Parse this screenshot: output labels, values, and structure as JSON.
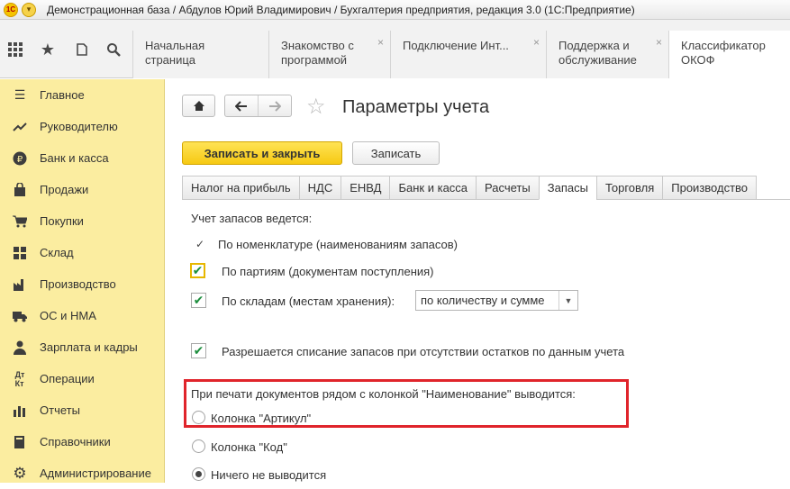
{
  "window": {
    "title": "Демонстрационная база / Абдулов Юрий Владимирович / Бухгалтерия предприятия, редакция 3.0  (1С:Предприятие)",
    "logo_text": "1С"
  },
  "toolbar": {
    "icons": [
      "apps-grid-icon",
      "star-icon",
      "history-icon",
      "search-icon"
    ]
  },
  "top_tabs": [
    {
      "label": "Начальная страница",
      "closable": false
    },
    {
      "label": "Знакомство с программой",
      "closable": true
    },
    {
      "label": "Подключение Инт...",
      "closable": true
    },
    {
      "label": "Поддержка и обслуживание",
      "closable": true
    },
    {
      "label": "Классификатор ОКОФ",
      "closable": false
    }
  ],
  "sidebar": {
    "items": [
      {
        "label": "Главное",
        "icon": "menu-lines-icon"
      },
      {
        "label": "Руководителю",
        "icon": "trend-icon"
      },
      {
        "label": "Банк и касса",
        "icon": "ruble-icon"
      },
      {
        "label": "Продажи",
        "icon": "bag-icon"
      },
      {
        "label": "Покупки",
        "icon": "cart-icon"
      },
      {
        "label": "Склад",
        "icon": "warehouse-icon"
      },
      {
        "label": "Производство",
        "icon": "factory-icon"
      },
      {
        "label": "ОС и НМА",
        "icon": "truck-icon"
      },
      {
        "label": "Зарплата и кадры",
        "icon": "person-icon"
      },
      {
        "label": "Операции",
        "icon": "debit-credit-icon"
      },
      {
        "label": "Отчеты",
        "icon": "bar-chart-icon"
      },
      {
        "label": "Справочники",
        "icon": "book-icon"
      },
      {
        "label": "Администрирование",
        "icon": "gear-icon"
      }
    ]
  },
  "form": {
    "title": "Параметры учета",
    "save_close_label": "Записать и закрыть",
    "save_label": "Записать",
    "tabs": [
      "Налог на прибыль",
      "НДС",
      "ЕНВД",
      "Банк и касса",
      "Расчеты",
      "Запасы",
      "Торговля",
      "Производство"
    ],
    "active_tab": "Запасы",
    "stock_heading": "Учет запасов ведется:",
    "by_nomenclature": "По номенклатуре (наименованиям запасов)",
    "by_batches": "По партиям (документам поступления)",
    "by_warehouses": "По складам (местам хранения):",
    "warehouse_mode": "по количеству и сумме",
    "allow_writeoff": "Разрешается списание запасов при отсутствии остатков по данным учета",
    "print_heading": "При печати документов рядом с колонкой \"Наименование\" выводится:",
    "radio_options": [
      "Колонка \"Артикул\"",
      "Колонка \"Код\"",
      "Ничего не выводится"
    ],
    "radio_selected": "Ничего не выводится"
  },
  "colors": {
    "sidebar_bg": "#fbeda0",
    "primary_button": "#f6c913",
    "highlight_box": "#e0242b",
    "check_color": "#1e8e3e"
  }
}
